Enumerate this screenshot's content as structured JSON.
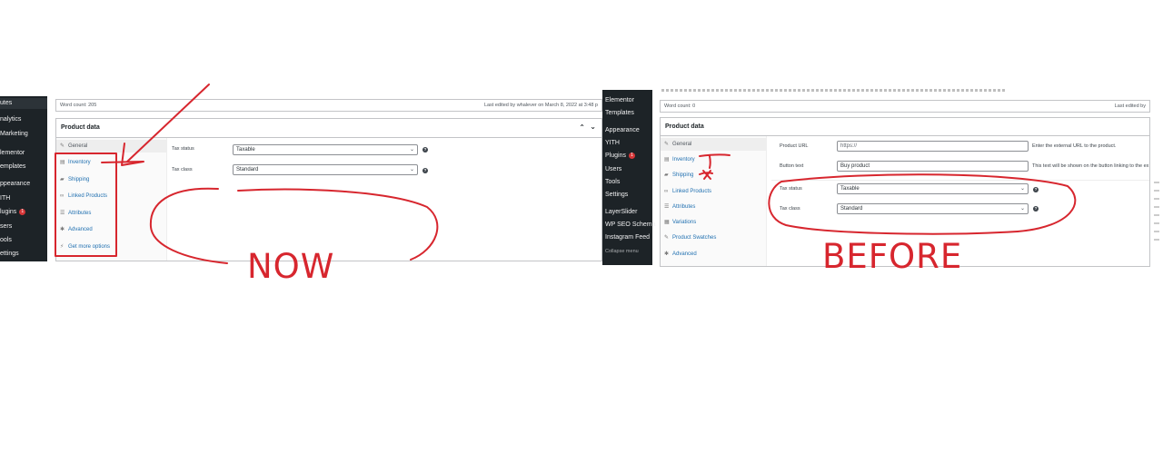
{
  "now": {
    "sidebar": [
      {
        "label": "utes",
        "active": true
      },
      {
        "label": "nalytics"
      },
      {
        "label": "Marketing"
      },
      {
        "label": "lementor"
      },
      {
        "label": "emplates"
      },
      {
        "label": "ppearance"
      },
      {
        "label": "ITH"
      },
      {
        "label": "lugins",
        "badge": "1"
      },
      {
        "label": "sers"
      },
      {
        "label": "ools"
      },
      {
        "label": "ettings"
      }
    ],
    "word_count": "Word count: 205",
    "last_edited": "Last edited by whalever on March 8, 2022 at 3:48 p",
    "product_data_title": "Product data",
    "tabs": [
      {
        "label": "General",
        "icon": "wrench-icon"
      },
      {
        "label": "Inventory",
        "icon": "clipboard-icon"
      },
      {
        "label": "Shipping",
        "icon": "truck-icon"
      },
      {
        "label": "Linked Products",
        "icon": "link-icon"
      },
      {
        "label": "Attributes",
        "icon": "list-icon"
      },
      {
        "label": "Advanced",
        "icon": "gear-icon"
      },
      {
        "label": "Get more options",
        "icon": "plug-icon"
      }
    ],
    "tax_status_label": "Tax status",
    "tax_status_value": "Taxable",
    "tax_class_label": "Tax class",
    "tax_class_value": "Standard",
    "caption": "NOW"
  },
  "before": {
    "sidebar": [
      {
        "label": "Elementor"
      },
      {
        "label": "Templates"
      },
      {
        "label": "Appearance"
      },
      {
        "label": "YITH"
      },
      {
        "label": "Plugins",
        "badge": "1"
      },
      {
        "label": "Users"
      },
      {
        "label": "Tools"
      },
      {
        "label": "Settings"
      },
      {
        "label": "LayerSlider"
      },
      {
        "label": "WP SEO Schema"
      },
      {
        "label": "Instagram Feed"
      },
      {
        "label": "Collapse menu"
      }
    ],
    "word_count": "Word count: 0",
    "last_edited": "Last edited by",
    "product_data_title": "Product data",
    "tabs": [
      {
        "label": "General",
        "icon": "wrench-icon"
      },
      {
        "label": "Inventory",
        "icon": "clipboard-icon"
      },
      {
        "label": "Shipping",
        "icon": "truck-icon"
      },
      {
        "label": "Linked Products",
        "icon": "link-icon"
      },
      {
        "label": "Attributes",
        "icon": "list-icon"
      },
      {
        "label": "Variations",
        "icon": "grid-icon"
      },
      {
        "label": "Product Swatches",
        "icon": "wrench-icon"
      },
      {
        "label": "Advanced",
        "icon": "gear-icon"
      }
    ],
    "product_url_label": "Product URL",
    "product_url_placeholder": "https://",
    "product_url_desc": "Enter the external URL to the product.",
    "button_text_label": "Button text",
    "button_text_value": "Buy product",
    "button_text_desc": "This text will be shown on the button linking to the ex",
    "tax_status_label": "Tax status",
    "tax_status_value": "Taxable",
    "tax_class_label": "Tax class",
    "tax_class_value": "Standard",
    "caption": "BEFORE"
  },
  "colors": {
    "annotation_red": "#d7262e",
    "admin_dark": "#1d2327",
    "link_blue": "#2271b1"
  }
}
